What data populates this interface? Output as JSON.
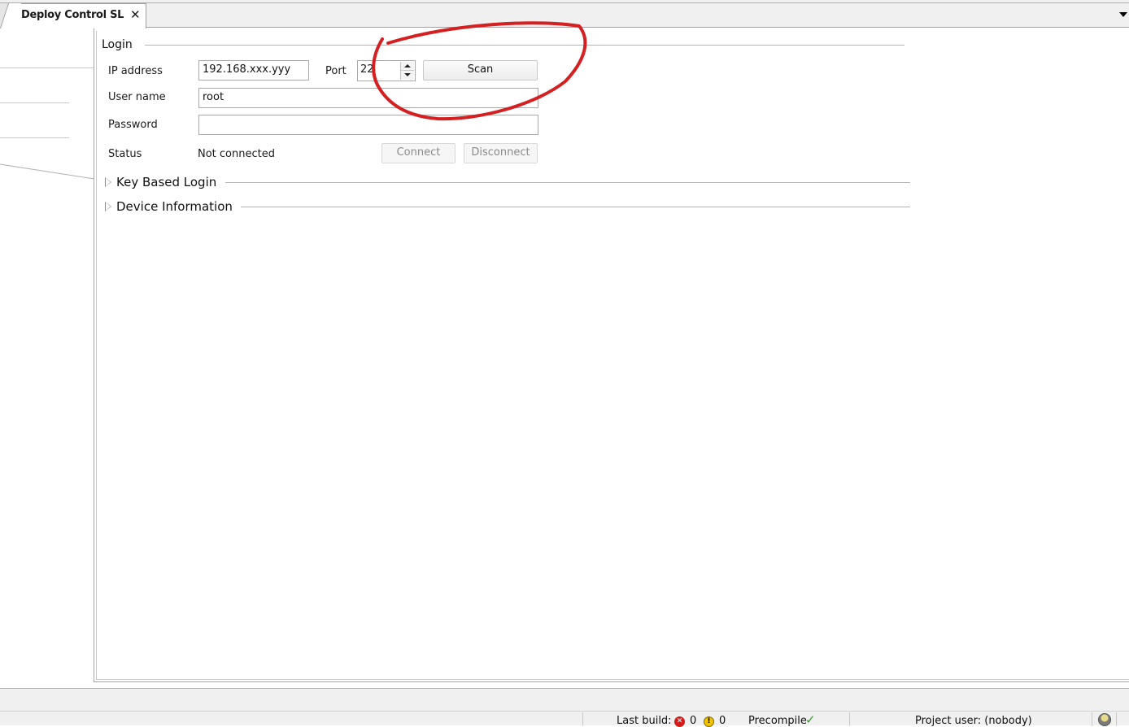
{
  "tab": {
    "title": "Deploy Control SL",
    "close_glyph": "✕"
  },
  "login": {
    "group_title": "Login",
    "ip_label": "IP address",
    "ip_value": "192.168.xxx.yyy",
    "port_label": "Port",
    "port_value": "22",
    "scan_label": "Scan",
    "user_label": "User name",
    "user_value": "root",
    "password_label": "Password",
    "password_value": "",
    "status_label": "Status",
    "status_value": "Not connected",
    "connect_label": "Connect",
    "disconnect_label": "Disconnect"
  },
  "sections": {
    "key_login": "Key Based Login",
    "device_info": "Device Information"
  },
  "status_bar": {
    "last_build_label": "Last build:",
    "error_count": "0",
    "warning_count": "0",
    "precompile_label": "Precompile",
    "project_user": "Project user: (nobody)"
  },
  "annotation": {
    "shape": "freehand-circle",
    "color": "#d42020",
    "target": "port-and-scan"
  },
  "icons": [
    "close-icon",
    "dropdown-arrow-icon",
    "spin-up-icon",
    "spin-down-icon",
    "expand-arrow-icon",
    "error-icon",
    "warning-icon",
    "check-icon",
    "user-icon"
  ]
}
